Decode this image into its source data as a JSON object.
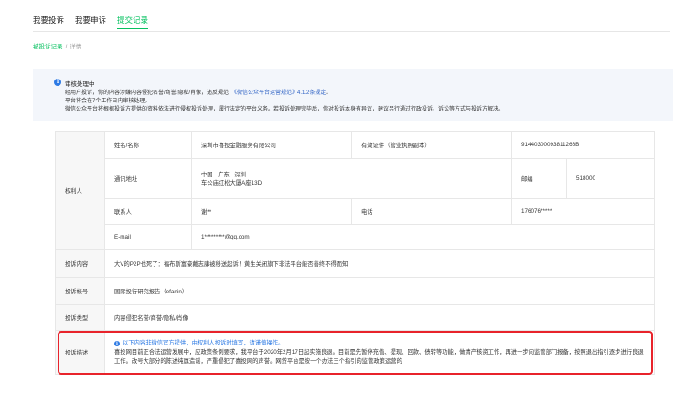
{
  "tabs": [
    {
      "label": "我要投诉"
    },
    {
      "label": "我要申诉"
    },
    {
      "label": "提交记录"
    }
  ],
  "breadcrumb": {
    "link": "被投诉记录",
    "separator": "/",
    "current": "详情"
  },
  "notice": {
    "title": "审核处理中",
    "line1_prefix": "经用户投诉，你的内容涉嫌内容侵犯名誉/商誉/隐私/肖像，违反规范：",
    "line1_link": "《微信公众平台运营规范》4.1.2条规定",
    "line1_suffix": "。",
    "line2": "平台将会在7个工作日内审核处理。",
    "line3": "微信公众平台将根据投诉方提供的资料依法进行侵权投诉处理，履行法定的平台义务。若投诉处理完毕后，你对投诉本身有异议，建议另行通过行政投诉、诉讼等方式与投诉方解决。"
  },
  "table": {
    "right_holder": {
      "label": "权利人",
      "name_key": "姓名/名称",
      "name_value": "深圳市喜投金融服务有限公司",
      "id_key": "有效证件（营业执照副本）",
      "id_value": "91440300093811266B",
      "address_key": "通讯地址",
      "address_line1": "中国 - 广东 - 深圳",
      "address_line2": "车公庙红松大厦A座13D",
      "postcode_key": "邮编",
      "postcode_value": "518000",
      "contact_key": "联系人",
      "contact_value": "谢**",
      "phone_key": "电话",
      "phone_value": "176076*****",
      "email_key": "E-mail",
      "email_value": "1*********@qq.com"
    },
    "content": {
      "label": "投诉内容",
      "value": "大V的P2P也死了：福布斯富豪戴志康被移送起诉！黄生关闭旗下非法平台能否善终不得而知"
    },
    "account": {
      "label": "投诉帐号",
      "value": "国际投行研究报告（efanin）"
    },
    "type": {
      "label": "投诉类型",
      "value": "内容侵犯名誉/商誉/隐私/肖像"
    },
    "description": {
      "label": "投诉描述",
      "hint": "以下内容非微信官方提供，由权利人投诉时填写，请谨慎操作。",
      "text": "喜投网目前正合法运营发展中，应政策条例要求，我平台于2020年2月17日起实施良退。目前是先暂停充值、提现、回款、债转等功能，做清产核资工作，再进一步向监管部门报备，按照退出指引逐步进行良退工作。改号大部分的陈述纯属造谣，严重侵犯了喜投网的声誉。网贷平台是按一个办法三个指引的监管政策运营的"
    }
  },
  "colors": {
    "accent": "#07c160",
    "link": "#2d61c4",
    "info": "#2d7ae4",
    "highlight": "#e8232b",
    "notice_bg": "#f3f6fb"
  }
}
